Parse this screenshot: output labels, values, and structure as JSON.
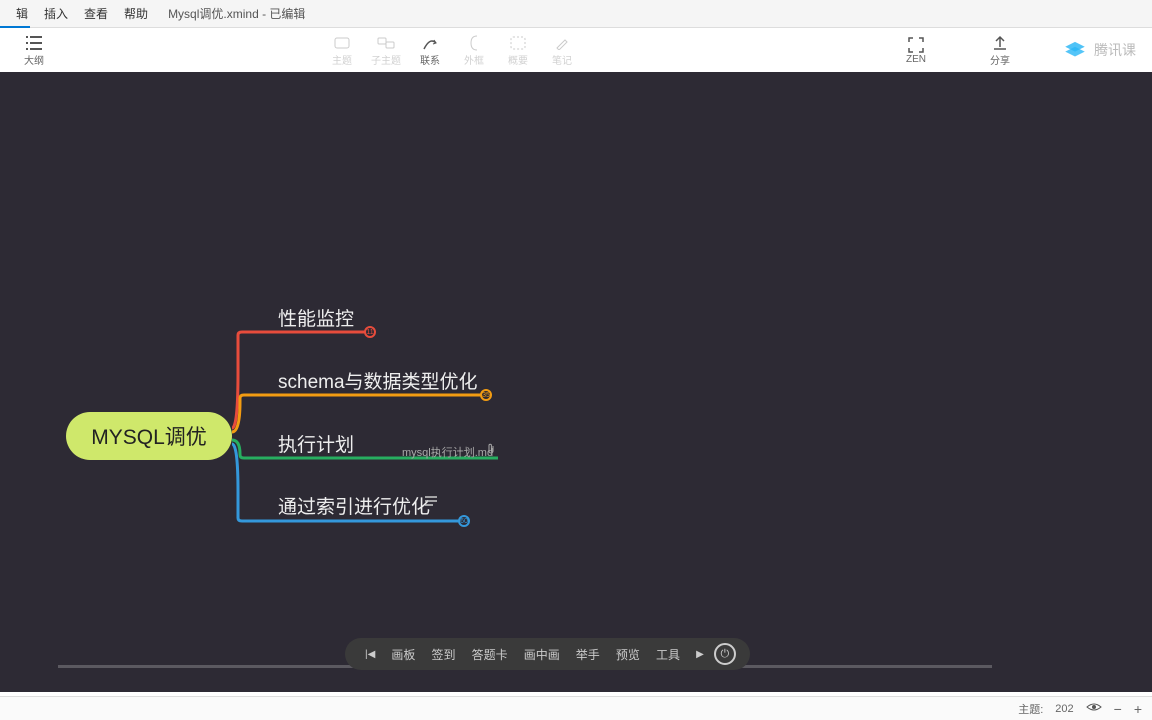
{
  "menu": {
    "edit": "辑",
    "insert": "插入",
    "view": "查看",
    "help": "帮助"
  },
  "window_title": "Mysql调优.xmind - 已编辑",
  "toolbar": {
    "outline": "大纲",
    "topic": "主题",
    "subtopic": "子主题",
    "relation": "联系",
    "summary": "外框",
    "boundary": "概要",
    "marker": "笔记",
    "zen": "ZEN",
    "share": "分享",
    "brand": "腾讯课"
  },
  "mindmap": {
    "root": "MYSQL调优",
    "branches": [
      {
        "label": "性能监控",
        "color": "#e74c3c",
        "collapse": "11"
      },
      {
        "label": "schema与数据类型优化",
        "color": "#f39c12",
        "collapse": "35"
      },
      {
        "label": "执行计划",
        "color": "#27ae60",
        "attachment": "mysql执行计划.md"
      },
      {
        "label": "通过索引进行优化",
        "color": "#3498db",
        "has_notes": true,
        "collapse": "60"
      }
    ]
  },
  "player": {
    "board": "画板",
    "signin": "签到",
    "quiz": "答题卡",
    "pip": "画中画",
    "raise": "举手",
    "preview": "预览",
    "tools": "工具"
  },
  "status": {
    "topics_label": "主题:",
    "topics_count": "202",
    "zoom_out": "−",
    "zoom_in": "+"
  }
}
